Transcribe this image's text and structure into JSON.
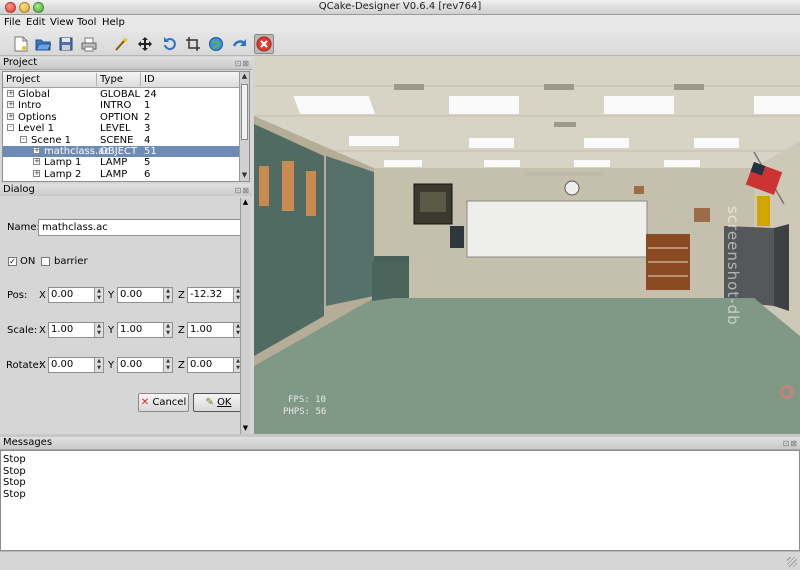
{
  "window": {
    "title": "QCake-Designer V0.6.4 [rev764]"
  },
  "menu": [
    "File",
    "Edit",
    "View",
    "Tool",
    "Help"
  ],
  "project": {
    "header": "Project",
    "columns": [
      "Project",
      "Type",
      "ID"
    ],
    "rows": [
      {
        "name": "Global",
        "type": "GLOBAL",
        "id": "24",
        "indent": 0,
        "expander": "+",
        "selected": false
      },
      {
        "name": "Intro",
        "type": "INTRO",
        "id": "1",
        "indent": 0,
        "expander": "+",
        "selected": false
      },
      {
        "name": "Options",
        "type": "OPTION",
        "id": "2",
        "indent": 0,
        "expander": "+",
        "selected": false
      },
      {
        "name": "Level 1",
        "type": "LEVEL",
        "id": "3",
        "indent": 0,
        "expander": "-",
        "selected": false
      },
      {
        "name": "Scene 1",
        "type": "SCENE",
        "id": "4",
        "indent": 1,
        "expander": "-",
        "selected": false
      },
      {
        "name": "mathclass.ac",
        "type": "OBJECT",
        "id": "51",
        "indent": 2,
        "expander": "+",
        "selected": true
      },
      {
        "name": "Lamp 1",
        "type": "LAMP",
        "id": "5",
        "indent": 2,
        "expander": "+",
        "selected": false
      },
      {
        "name": "Lamp 2",
        "type": "LAMP",
        "id": "6",
        "indent": 2,
        "expander": "+",
        "selected": false
      }
    ]
  },
  "dialog": {
    "header": "Dialog",
    "name_label": "Name:",
    "name_value": "mathclass.ac",
    "on_label": "ON",
    "on_checked": true,
    "barrier_label": "barrier",
    "barrier_checked": false,
    "pos_label": "Pos:",
    "scale_label": "Scale:",
    "rotate_label": "Rotate:",
    "axis": [
      "X",
      "Y",
      "Z"
    ],
    "pos": [
      "0.00",
      "0.00",
      "-12.32"
    ],
    "scale": [
      "1.00",
      "1.00",
      "1.00"
    ],
    "rotate": [
      "0.00",
      "0.00",
      "0.00"
    ],
    "cancel_label": "Cancel",
    "ok_label": "OK"
  },
  "viewport": {
    "fps_label": "FPS: 10",
    "phps_label": "PHPS: 56",
    "watermark": "screenshot-db"
  },
  "messages": {
    "header": "Messages",
    "lines": [
      "Stop",
      "Stop",
      "Stop",
      "Stop"
    ]
  },
  "colors": {
    "selection": "#6d8bb4",
    "floor": "#7f9986",
    "wall": "#c5bfae"
  }
}
